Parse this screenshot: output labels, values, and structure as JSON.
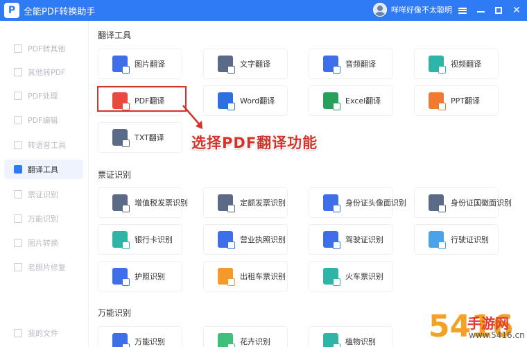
{
  "titlebar": {
    "logo_letter": "P",
    "title": "全能PDF转换助手",
    "username": "咩咩好像不太聪明",
    "close_glyph": "✕"
  },
  "sidebar": {
    "items": [
      {
        "label": "PDF转其他",
        "active": false
      },
      {
        "label": "其他转PDF",
        "active": false
      },
      {
        "label": "PDF处理",
        "active": false
      },
      {
        "label": "PDF编辑",
        "active": false
      },
      {
        "label": "转语音工具",
        "active": false
      },
      {
        "label": "翻译工具",
        "active": true
      },
      {
        "label": "票证识别",
        "active": false
      },
      {
        "label": "万能识别",
        "active": false
      },
      {
        "label": "图片转换",
        "active": false
      },
      {
        "label": "老照片修复",
        "active": false
      }
    ],
    "footer": {
      "label": "我的文件"
    }
  },
  "sections": {
    "translate": {
      "title": "翻译工具",
      "cards": [
        {
          "label": "图片翻译",
          "icon": "image-translate-icon",
          "color": "#3f6fe8"
        },
        {
          "label": "文字翻译",
          "icon": "text-translate-icon",
          "color": "#5b6a86"
        },
        {
          "label": "音频翻译",
          "icon": "audio-translate-icon",
          "color": "#3f6fe8"
        },
        {
          "label": "视频翻译",
          "icon": "video-translate-icon",
          "color": "#2fb5a8"
        },
        {
          "label": "PDF翻译",
          "icon": "pdf-translate-icon",
          "color": "#e84a3f"
        },
        {
          "label": "Word翻译",
          "icon": "word-translate-icon",
          "color": "#2d6fe0"
        },
        {
          "label": "Excel翻译",
          "icon": "excel-translate-icon",
          "color": "#26a05a"
        },
        {
          "label": "PPT翻译",
          "icon": "ppt-translate-icon",
          "color": "#f07a31"
        },
        {
          "label": "TXT翻译",
          "icon": "txt-translate-icon",
          "color": "#5b6a86"
        }
      ]
    },
    "ticket": {
      "title": "票证识别",
      "cards": [
        {
          "label": "增值税发票识别",
          "icon": "vat-invoice-icon",
          "color": "#5b6a86"
        },
        {
          "label": "定额发票识别",
          "icon": "quota-invoice-icon",
          "color": "#5b6a86"
        },
        {
          "label": "身份证头像面识别",
          "icon": "id-card-front-icon",
          "color": "#3f6fe8"
        },
        {
          "label": "身份证国徽面识别",
          "icon": "id-card-back-icon",
          "color": "#5b6a86"
        },
        {
          "label": "银行卡识别",
          "icon": "bank-card-icon",
          "color": "#2fb5a8"
        },
        {
          "label": "营业执照识别",
          "icon": "business-license-icon",
          "color": "#3f6fe8"
        },
        {
          "label": "驾驶证识别",
          "icon": "driver-license-icon",
          "color": "#3f6fe8"
        },
        {
          "label": "行驶证识别",
          "icon": "vehicle-license-icon",
          "color": "#4aa3e8"
        },
        {
          "label": "护照识别",
          "icon": "passport-icon",
          "color": "#3f6fe8"
        },
        {
          "label": "出租车票识别",
          "icon": "taxi-ticket-icon",
          "color": "#f39a2a"
        },
        {
          "label": "火车票识别",
          "icon": "train-ticket-icon",
          "color": "#2fb5a8"
        }
      ]
    },
    "universal": {
      "title": "万能识别",
      "cards": [
        {
          "label": "万能识别",
          "icon": "universal-recognition-icon",
          "color": "#3f6fe8"
        },
        {
          "label": "花卉识别",
          "icon": "flower-recognition-icon",
          "color": "#3fbf7a"
        },
        {
          "label": "植物识别",
          "icon": "plant-recognition-icon",
          "color": "#2fb5a8"
        }
      ]
    }
  },
  "annotation": {
    "callout_text": "选择PDF翻译功能"
  },
  "watermark": {
    "number": "5416",
    "site_name": "手游网",
    "url": "www.5416.cn"
  }
}
